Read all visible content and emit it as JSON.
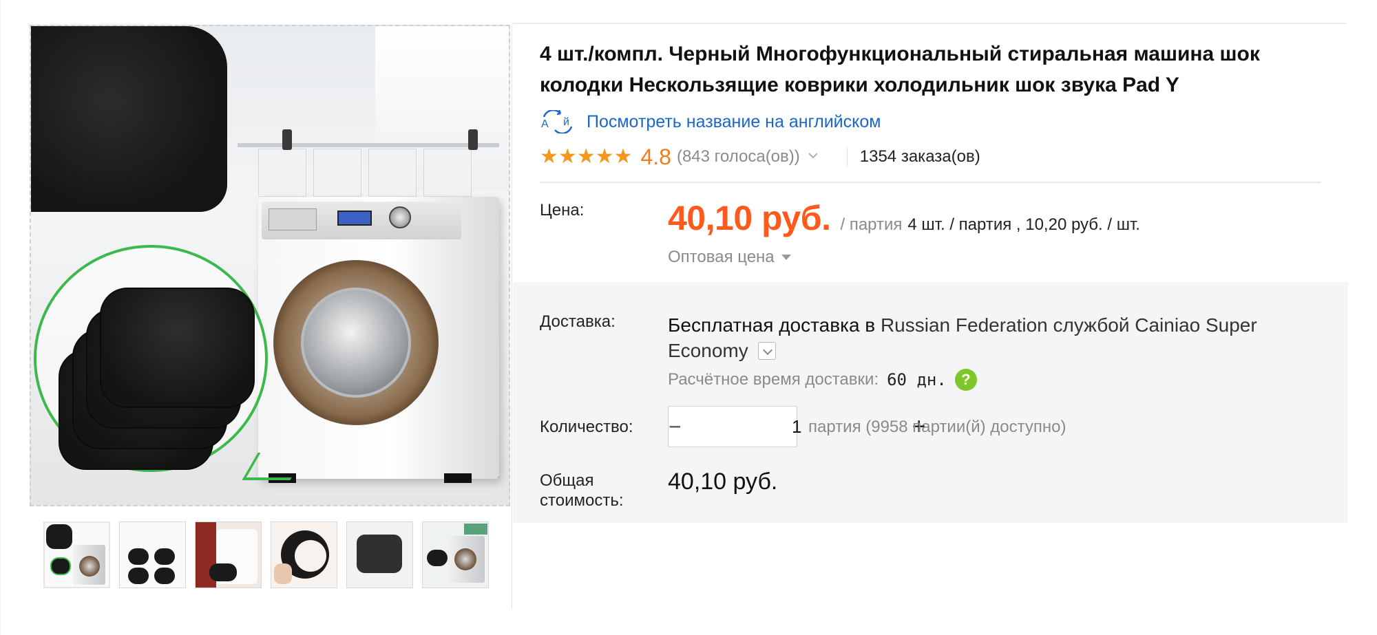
{
  "product": {
    "title": "4 шт./компл. Черный Многофункциональный стиральная машина шок колодки Нескользящие коврики холодильник шок звука Pad Y",
    "translate_link": "Посмотреть название на английском",
    "rating": {
      "stars": "★★★★★",
      "value": "4.8",
      "votes": "(843 голоса(ов))"
    },
    "orders": "1354 заказа(ов)"
  },
  "price": {
    "label": "Цена:",
    "amount": "40,10 руб.",
    "unit": "/ партия",
    "pack_info": "4 шт. / партия , 10,20 руб. / шт.",
    "wholesale": "Оптовая цена"
  },
  "shipping": {
    "label": "Доставка:",
    "free_text": "Бесплатная доставка в",
    "destination": "Russian Federation службой Cainiao Super Economy",
    "eta_label": "Расчётное время доставки:",
    "eta_days": "60 дн."
  },
  "quantity": {
    "label": "Количество:",
    "minus": "−",
    "plus": "+",
    "value": "1",
    "availability": "партия (9958 партии(й) доступно)"
  },
  "total": {
    "label": "Общая стоимость:",
    "value": "40,10 руб."
  },
  "colors": {
    "price": "#ff5a1e",
    "rating": "#f07c1a",
    "link": "#1a66c9",
    "help": "#7ec62a",
    "callout": "#3db84a"
  },
  "gallery": {
    "thumbnail_count": 6,
    "active_index": 0
  }
}
